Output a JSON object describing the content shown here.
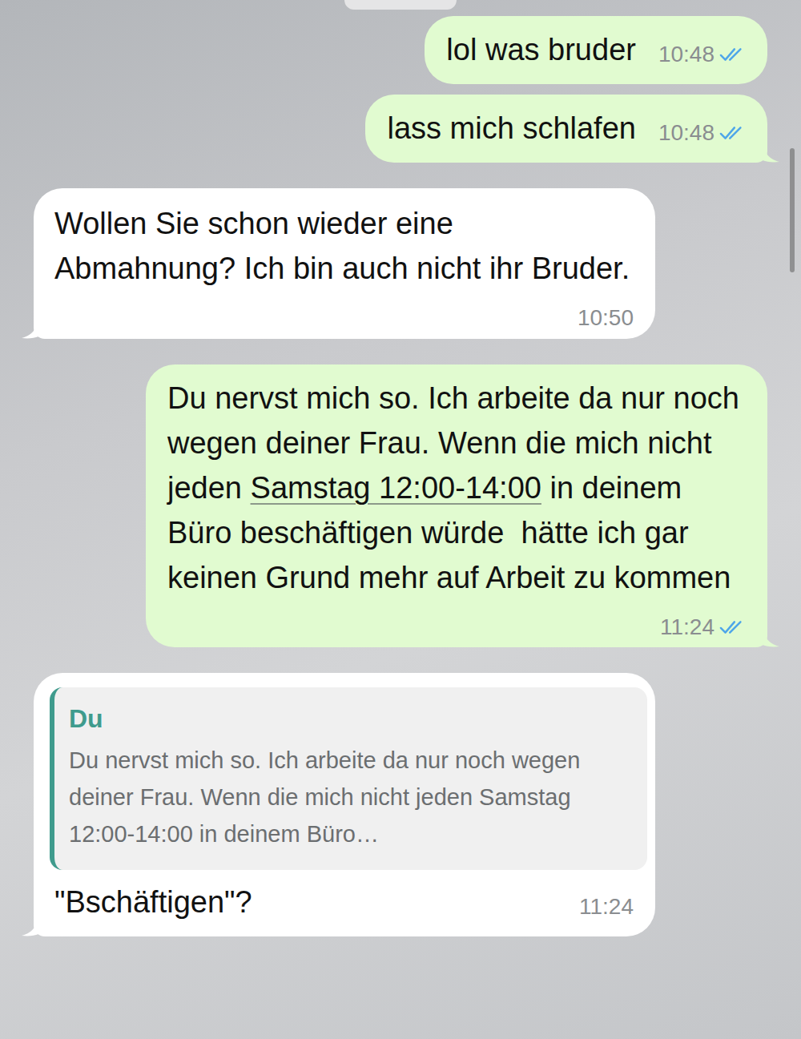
{
  "messages": [
    {
      "from": "me",
      "parts": [
        {
          "text": "lol was bruder",
          "link": false
        }
      ],
      "time": "10:48",
      "status": "read"
    },
    {
      "from": "me",
      "parts": [
        {
          "text": "lass mich schlafen",
          "link": false
        }
      ],
      "time": "10:48",
      "status": "read"
    },
    {
      "from": "them",
      "parts": [
        {
          "text": "Wollen Sie schon wieder eine Abmahnung? Ich bin auch nicht ihr Bruder.",
          "link": false
        }
      ],
      "time": "10:50"
    },
    {
      "from": "me",
      "parts": [
        {
          "text": "Du nervst mich so. Ich arbeite da nur noch wegen deiner Frau. Wenn die mich nicht jeden ",
          "link": false
        },
        {
          "text": "Samstag 12:00-14:00",
          "link": true
        },
        {
          "text": " in deinem Büro beschäftigen würde  hätte ich gar keinen Grund mehr auf Arbeit zu kommen",
          "link": false
        }
      ],
      "time": "11:24",
      "status": "read"
    },
    {
      "from": "them",
      "quote": {
        "author": "Du",
        "text": "Du nervst mich so. Ich arbeite da nur noch wegen deiner Frau. Wenn die mich nicht jeden Samstag 12:00-14:00 in deinem Büro…"
      },
      "parts": [
        {
          "text": "\"Bschäftigen\"?",
          "link": false
        }
      ],
      "time": "11:24"
    }
  ]
}
